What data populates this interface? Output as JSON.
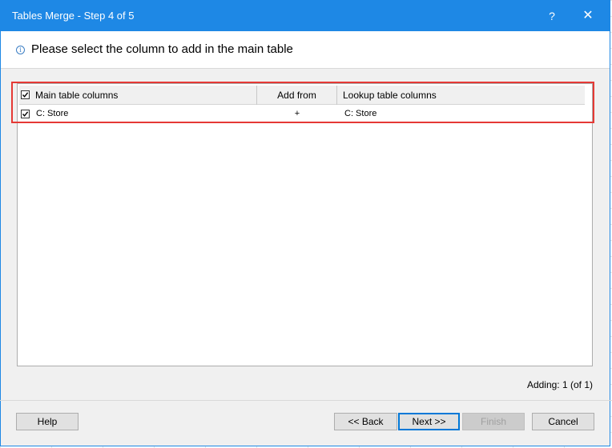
{
  "window": {
    "title": "Tables Merge - Step 4 of 5",
    "help_glyph": "?",
    "close_glyph": "✕"
  },
  "header": {
    "info_icon": "info-icon",
    "info_glyph": "i",
    "text": "Please select the column to add in the main table"
  },
  "table": {
    "columns": {
      "main": "Main table columns",
      "add": "Add from",
      "lookup": "Lookup table columns"
    },
    "header_checked": true,
    "rows": [
      {
        "checked": true,
        "main": "C: Store",
        "add": "+",
        "lookup": "C: Store"
      }
    ]
  },
  "status": "Adding: 1 (of 1)",
  "buttons": {
    "help": "Help",
    "back": "<< Back",
    "next": "Next >>",
    "finish": "Finish",
    "cancel": "Cancel"
  },
  "colors": {
    "titlebar": "#1e88e5",
    "highlight": "#e53935"
  }
}
